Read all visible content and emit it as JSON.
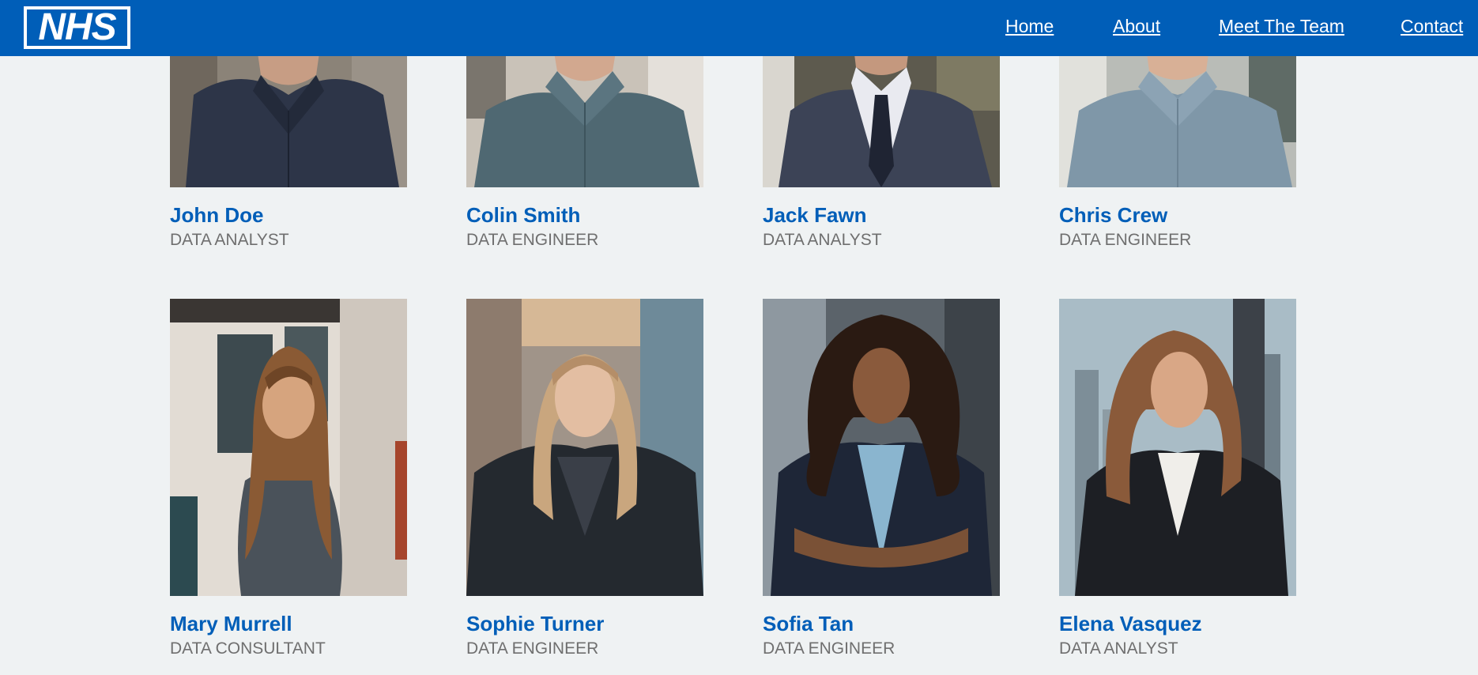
{
  "header": {
    "logo_text": "NHS",
    "nav": [
      "Home",
      "About",
      "Meet The Team",
      "Contact"
    ]
  },
  "team": [
    {
      "name": "John Doe",
      "role": "DATA ANALYST"
    },
    {
      "name": "Colin Smith",
      "role": "DATA ENGINEER"
    },
    {
      "name": "Jack Fawn",
      "role": "DATA ANALYST"
    },
    {
      "name": "Chris Crew",
      "role": "DATA ENGINEER"
    },
    {
      "name": "Mary Murrell",
      "role": "DATA CONSULTANT"
    },
    {
      "name": "Sophie Turner",
      "role": "DATA ENGINEER"
    },
    {
      "name": "Sofia Tan",
      "role": "DATA ENGINEER"
    },
    {
      "name": "Elena Vasquez",
      "role": "DATA ANALYST"
    }
  ],
  "colors": {
    "brand": "#005eb8",
    "background": "#eff2f3",
    "role_text": "#6f6f6f"
  }
}
